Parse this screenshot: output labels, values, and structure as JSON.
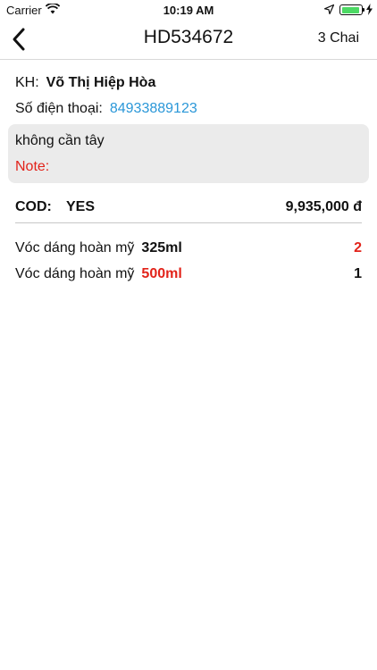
{
  "status_bar": {
    "carrier": "Carrier",
    "time": "10:19 AM"
  },
  "nav": {
    "title": "HD534672",
    "right_label": "3 Chai"
  },
  "customer": {
    "name_label": "KH:",
    "name": "Võ Thị Hiệp Hòa",
    "phone_label": "Số điện thoại:",
    "phone": "84933889123"
  },
  "note": {
    "text": "không cần tây",
    "label": "Note:"
  },
  "cod": {
    "label": "COD:",
    "value": "YES",
    "total": "9,935,000 đ"
  },
  "items": [
    {
      "name": "Vóc dáng hoàn mỹ",
      "size": "325ml",
      "qty": "2"
    },
    {
      "name": "Vóc dáng hoàn mỹ",
      "size": "500ml",
      "qty": "1"
    }
  ],
  "colors": {
    "accent_red": "#e2231a",
    "link_blue": "#2a97d8",
    "battery_green": "#4cd964"
  }
}
